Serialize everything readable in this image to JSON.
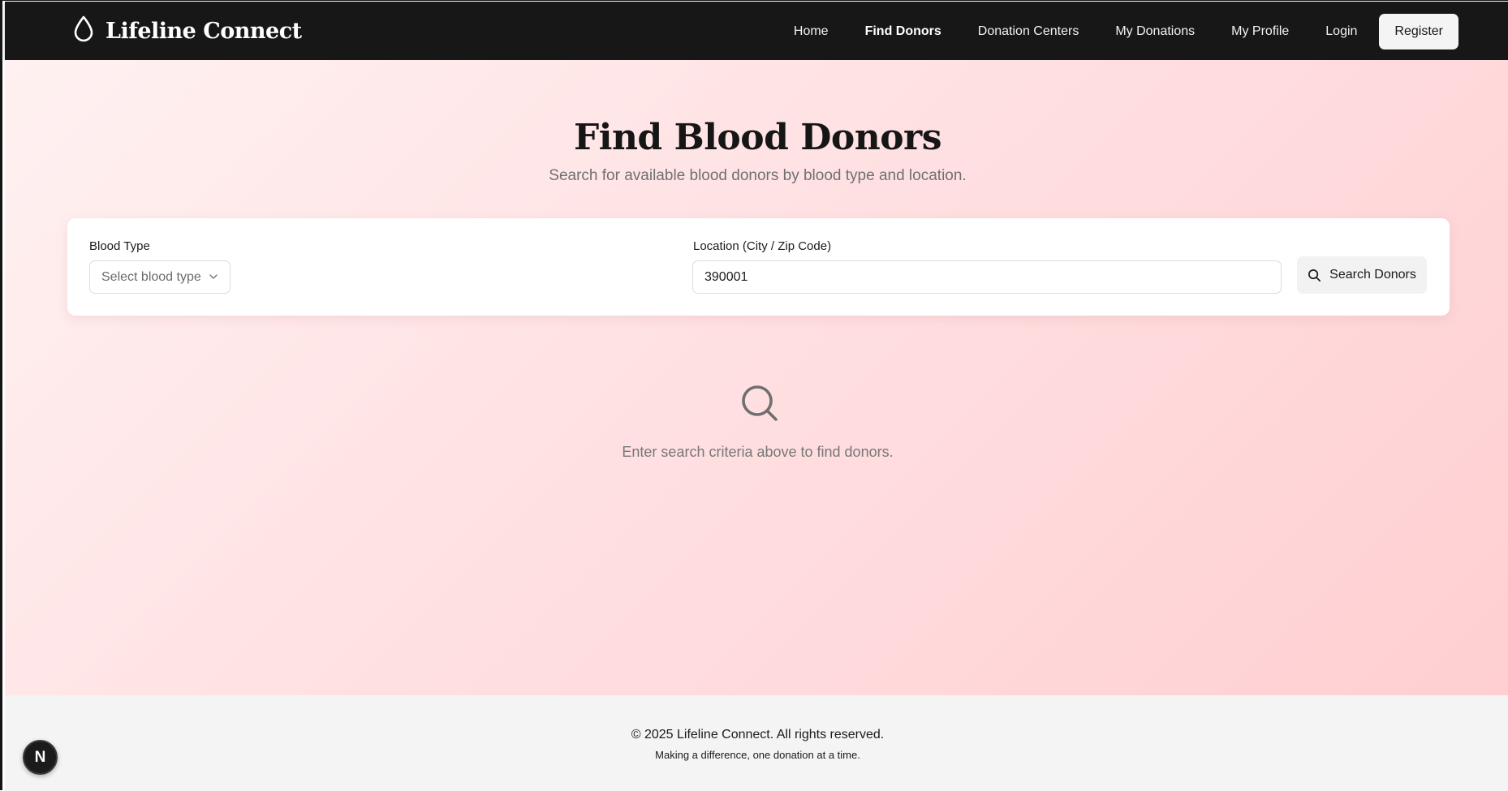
{
  "header": {
    "brand": "Lifeline Connect",
    "nav": [
      {
        "label": "Home",
        "active": false
      },
      {
        "label": "Find Donors",
        "active": true
      },
      {
        "label": "Donation Centers",
        "active": false
      },
      {
        "label": "My Donations",
        "active": false
      },
      {
        "label": "My Profile",
        "active": false
      },
      {
        "label": "Login",
        "active": false
      }
    ],
    "register_label": "Register"
  },
  "hero": {
    "title": "Find Blood Donors",
    "subtitle": "Search for available blood donors by blood type and location."
  },
  "search": {
    "blood_type_label": "Blood Type",
    "blood_type_placeholder": "Select blood type",
    "location_label": "Location (City / Zip Code)",
    "location_value": "390001",
    "button_label": "Search Donors"
  },
  "empty_state": {
    "icon": "search-icon",
    "message": "Enter search criteria above to find donors."
  },
  "footer": {
    "copyright": "© 2025 Lifeline Connect. All rights reserved.",
    "tagline": "Making a difference, one donation at a time."
  },
  "dev_badge": {
    "letter": "N"
  },
  "colors": {
    "navbar": "#171717",
    "gradient_start": "#fff1f1",
    "gradient_end": "#ffcfd1",
    "footer": "#f4f4f4"
  }
}
